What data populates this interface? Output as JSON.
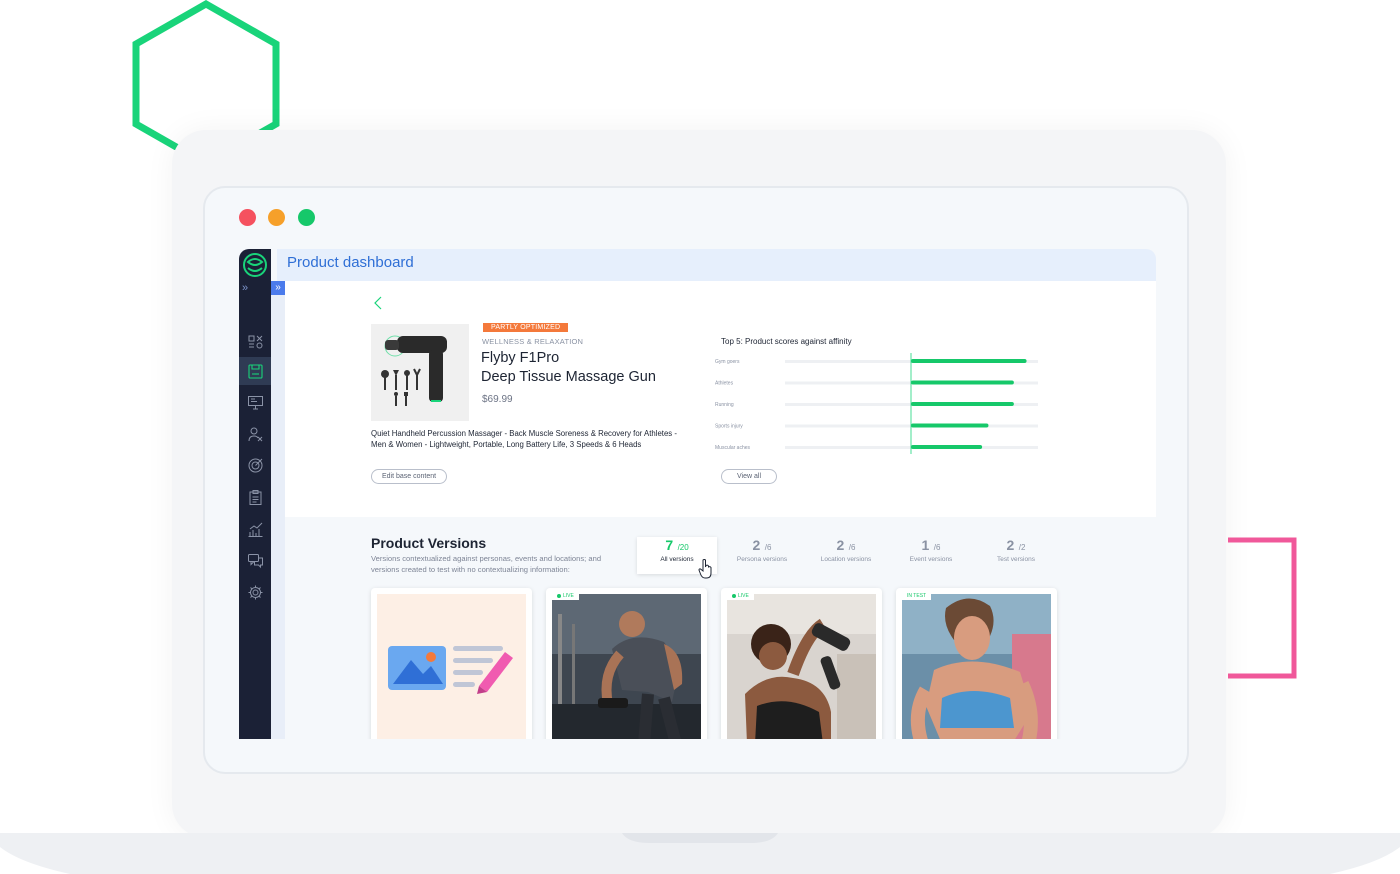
{
  "app": {
    "page_title": "Product dashboard",
    "expand_icon": "double-chevron-right-icon",
    "collapse_icon": "double-chevron-right-icon"
  },
  "sidebar": {
    "items": [
      {
        "icon": "tools-icon"
      },
      {
        "icon": "product-icon",
        "active": true
      },
      {
        "icon": "monitor-icon"
      },
      {
        "icon": "persona-icon"
      },
      {
        "icon": "target-icon"
      },
      {
        "icon": "clipboard-icon"
      },
      {
        "icon": "analytics-icon"
      },
      {
        "icon": "chat-icon"
      },
      {
        "icon": "gear-icon"
      }
    ]
  },
  "product": {
    "badge": "PARTLY OPTIMIZED",
    "category": "WELLNESS & RELAXATION",
    "name_line1": "Flyby F1Pro",
    "name_line2": "Deep Tissue Massage Gun",
    "price": "$69.99",
    "description": "Quiet Handheld Percussion Massager - Back Muscle Soreness & Recovery for Athletes - Men & Women - Lightweight, Portable, Long Battery Life, 3 Speeds & 6 Heads",
    "edit_label": "Edit base content"
  },
  "scores": {
    "title": "Top 5: Product scores against affinity",
    "view_all_label": "View all",
    "rows": [
      {
        "label": "Gym goers",
        "value": 0.91
      },
      {
        "label": "Athletes",
        "value": 0.81
      },
      {
        "label": "Running",
        "value": 0.81
      },
      {
        "label": "Sports injury",
        "value": 0.61
      },
      {
        "label": "Muscular aches",
        "value": 0.56
      }
    ]
  },
  "versions": {
    "title": "Product Versions",
    "subtitle": "Versions contextualized against personas, events and locations; and versions created to test with no contextualizing information:",
    "stats": [
      {
        "num": "7",
        "den": "/20",
        "label": "All versions",
        "active": true
      },
      {
        "num": "2",
        "den": "/6",
        "label": "Persona versions"
      },
      {
        "num": "2",
        "den": "/6",
        "label": "Location versions"
      },
      {
        "num": "1",
        "den": "/6",
        "label": "Event versions"
      },
      {
        "num": "2",
        "den": "/2",
        "label": "Test versions"
      }
    ],
    "cards": [
      {
        "status": "",
        "image": "image-text-illustration"
      },
      {
        "status": "LIVE",
        "image": "man-lifting-dumbbell-photo"
      },
      {
        "status": "LIVE",
        "image": "woman-using-massage-gun-photo"
      },
      {
        "status": "IN TEST",
        "image": "woman-exercising-photo"
      }
    ]
  },
  "colors": {
    "accent_green": "#16c86a",
    "accent_blue": "#2f6fd6",
    "badge_orange": "#f4793b",
    "sidebar_navy": "#1b2136",
    "decor_pink": "#f0589a"
  }
}
